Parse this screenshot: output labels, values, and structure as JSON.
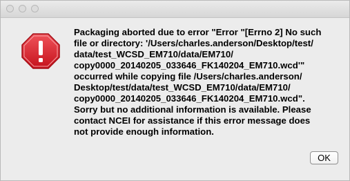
{
  "dialog": {
    "message": "Packaging aborted due to error \"Error \"[Errno 2] No such\nfile or directory: '/Users/charles.anderson/Desktop/test/\ndata/test_WCSD_EM710/data/EM710/\ncopy0000_20140205_033646_FK140204_EM710.wcd'\"\noccurred while copying file /Users/charles.anderson/\nDesktop/test/data/test_WCSD_EM710/data/EM710/\ncopy0000_20140205_033646_FK140204_EM710.wcd\".\nSorry but no additional information is available. Please\ncontact NCEI for assistance if this error message does\nnot provide enough information.",
    "ok_label": "OK",
    "icon": "error-stop-sign-icon",
    "icon_color": "#d0202a"
  }
}
